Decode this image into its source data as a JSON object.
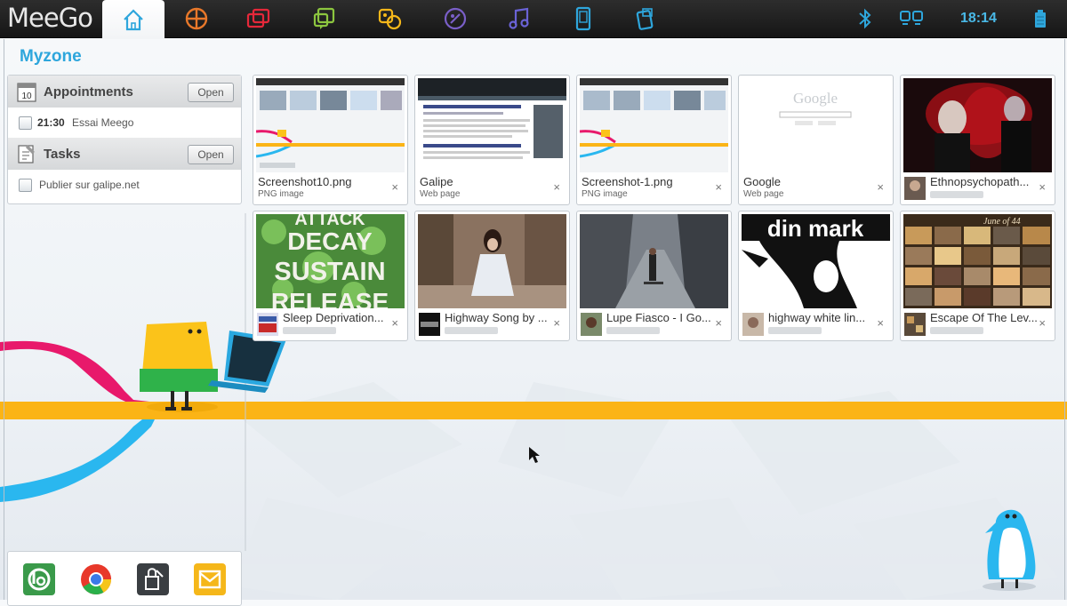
{
  "app": {
    "logo": "MeeGo"
  },
  "topbar": {
    "tabs": [
      {
        "name": "myzone",
        "icon": "home-icon"
      },
      {
        "name": "status",
        "icon": "status-icon"
      },
      {
        "name": "people",
        "icon": "people-icon"
      },
      {
        "name": "internet",
        "icon": "internet-icon"
      },
      {
        "name": "media",
        "icon": "media-icon"
      },
      {
        "name": "pasteboard",
        "icon": "pasteboard-icon"
      },
      {
        "name": "music",
        "icon": "music-icon"
      },
      {
        "name": "devices",
        "icon": "devices-icon"
      },
      {
        "name": "applications",
        "icon": "applications-icon"
      }
    ],
    "status_icons": [
      "bluetooth-icon",
      "network-icon",
      "battery-icon"
    ],
    "clock": "18:14",
    "accent": "#2ea6dc"
  },
  "zone": {
    "title": "Myzone"
  },
  "panels": {
    "appointments": {
      "label": "Appointments",
      "calendar_day": "10",
      "open_label": "Open",
      "items": [
        {
          "time": "21:30",
          "text": "Essai Meego"
        }
      ]
    },
    "tasks": {
      "label": "Tasks",
      "open_label": "Open",
      "items": [
        {
          "text": "Publier sur galipe.net"
        }
      ]
    }
  },
  "grid": {
    "items": [
      {
        "name": "Screenshot10.png",
        "type": "PNG image"
      },
      {
        "name": "Galipe",
        "type": "Web page"
      },
      {
        "name": "Screenshot-1.png",
        "type": "PNG image"
      },
      {
        "name": "Google",
        "type": "Web page"
      },
      {
        "name": "Ethnopsychopath...",
        "type": ""
      },
      {
        "name": "Sleep Deprivation...",
        "type": ""
      },
      {
        "name": "Highway Song by ...",
        "type": ""
      },
      {
        "name": "Lupe Fiasco - I Go...",
        "type": ""
      },
      {
        "name": "highway white lin...",
        "type": ""
      },
      {
        "name": "Escape Of The Lev...",
        "type": ""
      }
    ],
    "close_glyph": "×",
    "thumb_texts": {
      "google_logo": "Google",
      "decay_lines": [
        "ATTACK",
        "DECAY",
        "SUSTAIN",
        "RELEASE"
      ],
      "din_mark": "din mark",
      "june": "June of 44"
    }
  },
  "dock": {
    "icons": [
      "blip-icon",
      "chrome-icon",
      "lock-app-icon",
      "mail-icon"
    ]
  }
}
